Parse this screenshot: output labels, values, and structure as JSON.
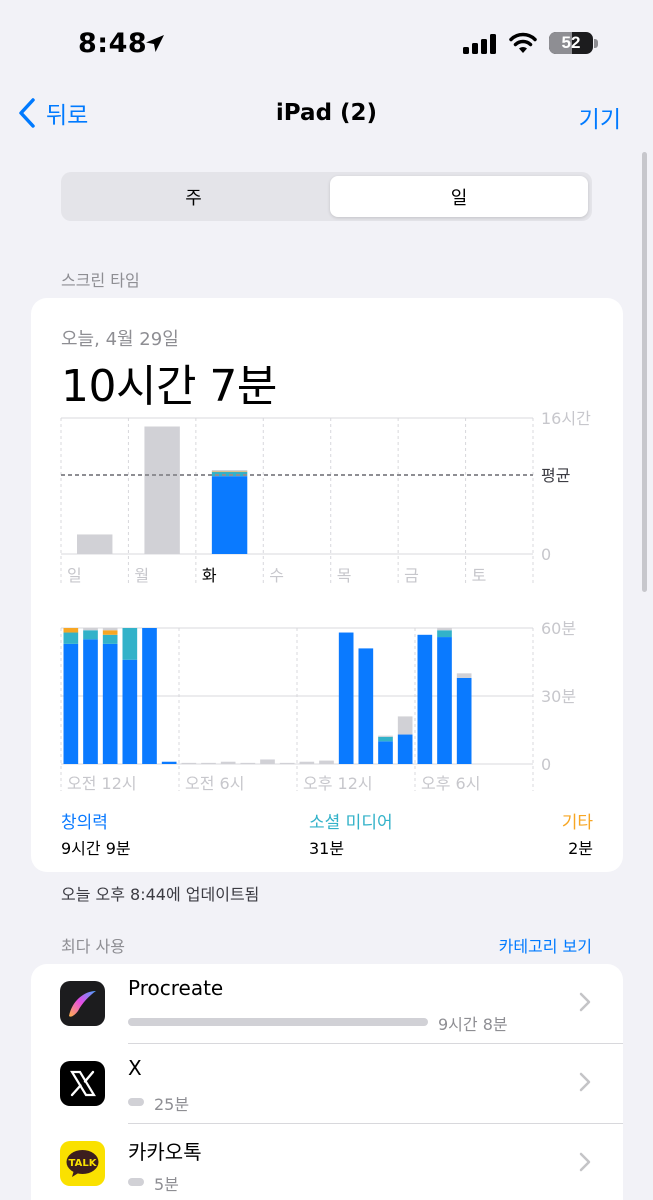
{
  "status_bar": {
    "time": "8:48",
    "battery": "52",
    "battery_level": 0.52
  },
  "nav": {
    "back_label": "뒤로",
    "title": "iPad (2)",
    "right_label": "기기"
  },
  "segment": {
    "options": [
      "주",
      "일"
    ],
    "selected": "일"
  },
  "screen_time": {
    "section_label": "스크린 타임",
    "date_label": "오늘, 4월 29일",
    "total": "10시간 7분"
  },
  "chart_data": [
    {
      "type": "bar",
      "categories": [
        "일",
        "월",
        "화",
        "수",
        "목",
        "금",
        "토"
      ],
      "y_unit": "hours",
      "ylim": [
        0,
        16
      ],
      "y_tick_labels": [
        "16시간",
        "평균",
        "0"
      ],
      "average": 9.3,
      "selected_category": "화",
      "series": [
        {
          "name": "창의력",
          "values": [
            2.3,
            15.0,
            9.15,
            0,
            0,
            0,
            0
          ]
        },
        {
          "name": "소셜 미디어",
          "values": [
            0,
            0,
            0.52,
            0,
            0,
            0,
            0
          ]
        },
        {
          "name": "기타",
          "values": [
            0,
            0,
            0.03,
            0,
            0,
            0,
            0
          ]
        },
        {
          "name": "",
          "values": [
            0,
            0,
            0.18,
            0,
            0,
            0,
            0
          ]
        }
      ],
      "colors": [
        "#0a7aff",
        "#32b2c9",
        "#f7a623",
        "#d1d1d6"
      ],
      "grid": true
    },
    {
      "type": "bar",
      "x_tick_labels": [
        "오전 12시",
        "오전 6시",
        "오후 12시",
        "오후 6시"
      ],
      "y_unit": "minutes",
      "ylim": [
        0,
        60
      ],
      "y_tick_labels": [
        "60분",
        "30분",
        "0"
      ],
      "hours": [
        0,
        1,
        2,
        3,
        4,
        5,
        6,
        7,
        8,
        9,
        10,
        11,
        12,
        13,
        14,
        15,
        16,
        17,
        18,
        19,
        20,
        21,
        22,
        23
      ],
      "series": [
        {
          "name": "창의력",
          "values": [
            53,
            55,
            53,
            46,
            60,
            1,
            0,
            0,
            0,
            0,
            0,
            0,
            0,
            0,
            58,
            51,
            10,
            13,
            57,
            56,
            38,
            0,
            0,
            0
          ]
        },
        {
          "name": "소셜 미디어",
          "values": [
            5,
            4,
            4,
            14,
            0,
            0,
            0,
            0,
            0,
            0,
            0,
            0,
            0,
            0,
            0,
            0,
            2,
            0,
            0,
            3,
            0,
            0,
            0,
            0
          ]
        },
        {
          "name": "기타",
          "values": [
            2,
            0,
            2,
            0,
            0,
            0,
            0,
            0,
            0,
            0,
            0,
            0,
            0,
            0,
            0,
            0,
            0,
            0,
            0,
            0,
            0,
            0,
            0,
            0
          ]
        },
        {
          "name": "",
          "values": [
            0,
            1,
            1,
            0,
            0,
            0,
            0.5,
            0.5,
            1,
            0.5,
            2,
            0.5,
            1,
            1.5,
            0,
            0,
            0.5,
            8,
            0,
            1,
            2,
            0,
            0,
            0
          ]
        }
      ],
      "colors": [
        "#0a7aff",
        "#32b2c9",
        "#f7a623",
        "#d1d1d6"
      ],
      "grid": true
    }
  ],
  "legend": [
    {
      "name": "창의력",
      "value": "9시간 9분",
      "color": "#0a7aff"
    },
    {
      "name": "소셜 미디어",
      "value": "31분",
      "color": "#32b2c9"
    },
    {
      "name": "기타",
      "value": "2분",
      "color": "#f7a623"
    }
  ],
  "updated_text": "오늘 오후 8:44에 업데이트됨",
  "most_used": {
    "section_label": "최다 사용",
    "category_link": "카테고리 보기",
    "apps": [
      {
        "name": "Procreate",
        "time": "9시간 8분",
        "fraction": 1.0
      },
      {
        "name": "X",
        "time": "25분",
        "fraction": 0.05
      },
      {
        "name": "카카오톡",
        "time": "5분",
        "fraction": 0.05
      }
    ]
  },
  "icons": {
    "back": "chevron-left-icon",
    "location": "location-arrow-icon",
    "signal": "cellular-signal-icon",
    "wifi": "wifi-icon",
    "battery": "battery-icon",
    "kakao_badge": "TALK"
  }
}
